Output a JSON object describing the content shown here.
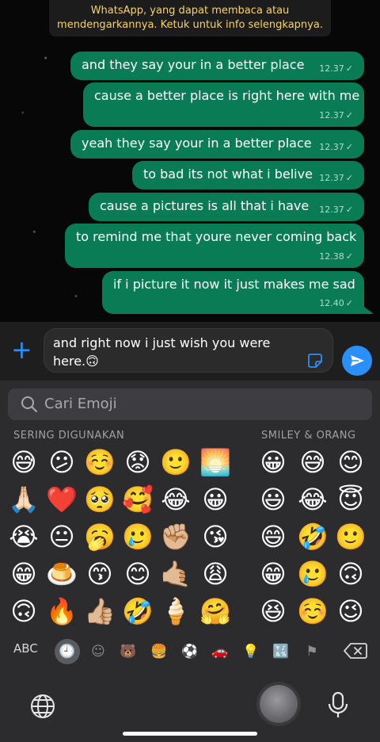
{
  "system_notice": {
    "line1": "WhatsApp, yang dapat membaca atau",
    "line2": "mendengarkannya. Ketuk untuk info selengkapnya."
  },
  "messages": [
    {
      "text": "and they say your in a better place",
      "time": "12.37"
    },
    {
      "text": "cause a better place is right here with me",
      "time": "12.37"
    },
    {
      "text": "yeah they say your in a better place",
      "time": "12.37"
    },
    {
      "text": "to bad its not what i belive",
      "time": "12.37"
    },
    {
      "text": "cause a pictures is all that i have",
      "time": "12.37"
    },
    {
      "text": "to remind me that youre never coming back",
      "time": "12.38"
    },
    {
      "text": "if i picture it now it just makes me sad",
      "time": "12.40"
    }
  ],
  "composer": {
    "line1": "and right now i just wish you were",
    "line2": "here.🙃"
  },
  "emoji_keyboard": {
    "search_placeholder": "Cari Emoji",
    "frequent_label": "SERING DIGUNAKAN",
    "smiley_label": "SMILEY & ORANG",
    "frequent": [
      [
        "😅",
        "😕",
        "☺️",
        "😟",
        "🙂",
        "🌅"
      ],
      [
        "🙏🏻",
        "❤️",
        "🥺",
        "🥰",
        "😂",
        "😀"
      ],
      [
        "😭",
        "😐",
        "🥱",
        "🥲",
        "✊🏼",
        "😘"
      ],
      [
        "😁",
        "🍮",
        "😙",
        "😊",
        "🤙🏼",
        "😩"
      ],
      [
        "🙃",
        "🔥",
        "👍🏼",
        "🤣",
        "🍦",
        "🤗"
      ]
    ],
    "smileys": [
      [
        "😀",
        "😅",
        "😊"
      ],
      [
        "😃",
        "😂",
        "😇"
      ],
      [
        "😄",
        "🤣",
        "🙂"
      ],
      [
        "😁",
        "🥲",
        "🙃"
      ],
      [
        "😆",
        "☺️",
        "😉"
      ]
    ],
    "abc_label": "ABC",
    "categories": [
      "🕘",
      "☺",
      "🐻",
      "🍔",
      "⚽",
      "🚗",
      "💡",
      "🔣",
      "⚑"
    ]
  }
}
